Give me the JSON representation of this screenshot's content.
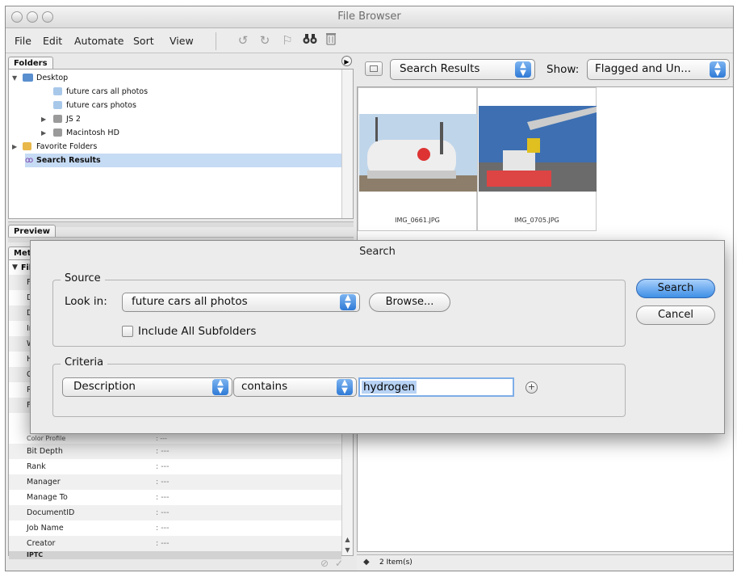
{
  "window": {
    "title": "File Browser"
  },
  "menu": [
    "File",
    "Edit",
    "Automate",
    "Sort",
    "View"
  ],
  "toolbar_icons": [
    "rotate-ccw-icon",
    "rotate-cw-icon",
    "flag-icon",
    "binoculars-icon",
    "trash-icon"
  ],
  "folders": {
    "tab_label": "Folders",
    "items": [
      {
        "label": "Desktop"
      },
      {
        "label": "future cars all photos"
      },
      {
        "label": "future cars photos"
      },
      {
        "label": "JS 2"
      },
      {
        "label": "Macintosh HD"
      },
      {
        "label": "Favorite Folders"
      },
      {
        "label": "Search Results"
      }
    ]
  },
  "preview": {
    "tab_label": "Preview"
  },
  "metadata": {
    "tab_label": "Metad",
    "section_label": "Fil",
    "hidden_rows": [
      "Fil",
      "Da",
      "Da",
      "Im",
      "W",
      "He",
      "Co",
      "Re",
      "Fil",
      "Color Profile"
    ],
    "rows": [
      {
        "key": "Bit Depth",
        "value": ": ---"
      },
      {
        "key": "Rank",
        "value": ": ---"
      },
      {
        "key": "Manager",
        "value": ": ---"
      },
      {
        "key": "Manage To",
        "value": ": ---"
      },
      {
        "key": "DocumentID",
        "value": ": ---"
      },
      {
        "key": "Job Name",
        "value": ": ---"
      },
      {
        "key": "Creator",
        "value": ": ---"
      }
    ],
    "next_section": "IPTC"
  },
  "browser": {
    "location": "Search Results",
    "show_label": "Show:",
    "show_value": "Flagged and Un...",
    "thumbnails": [
      {
        "filename": "IMG_0661.JPG"
      },
      {
        "filename": "IMG_0705.JPG"
      }
    ],
    "status": "2 Item(s)"
  },
  "search_dialog": {
    "title": "Search",
    "source_label": "Source",
    "look_in_label": "Look in:",
    "look_in_value": "future cars all photos",
    "browse_button": "Browse...",
    "include_subfolders_label": "Include All Subfolders",
    "include_subfolders_checked": false,
    "criteria_label": "Criteria",
    "criteria_field": "Description",
    "criteria_operator": "contains",
    "criteria_value": "hydrogen",
    "search_button": "Search",
    "cancel_button": "Cancel",
    "colors": {
      "default_button": "#4a90e2",
      "selection": "#b7d2f4"
    }
  }
}
